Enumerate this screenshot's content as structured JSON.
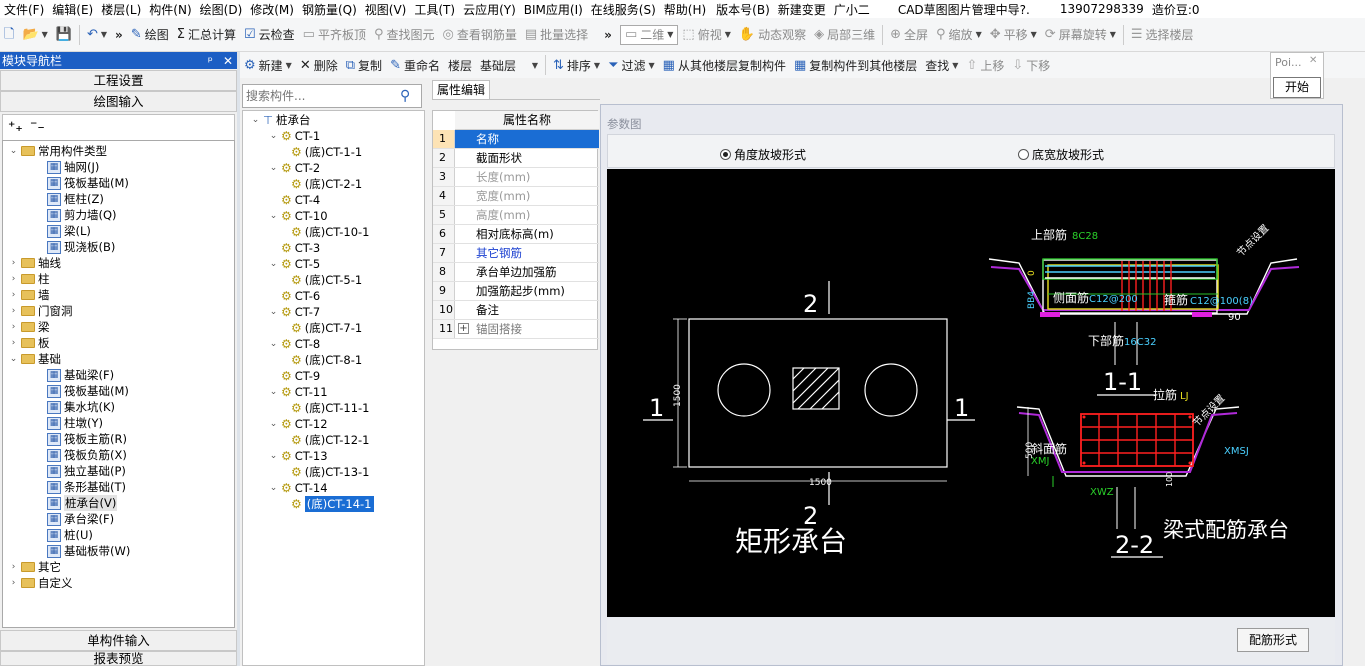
{
  "menu": [
    "文件(F)",
    "编辑(E)",
    "楼层(L)",
    "构件(N)",
    "绘图(D)",
    "修改(M)",
    "钢筋量(Q)",
    "视图(V)",
    "工具(T)",
    "云应用(Y)",
    "BIM应用(I)",
    "在线服务(S)",
    "帮助(H)",
    "版本号(B)",
    "新建变更",
    "广小二",
    "CAD草图图片管理中导?.",
    "13907298339",
    "造价豆:0"
  ],
  "toolbar1": {
    "draw": "绘图",
    "sum": "汇总计算",
    "cloud": "云检查",
    "flat": "平齐板顶",
    "find": "查找图元",
    "view_rebar": "查看钢筋量",
    "batch": "批量选择",
    "mode": "二维",
    "top": "俯视",
    "dynamic": "动态观察",
    "local3d": "局部三维",
    "fullscreen": "全屏",
    "zoom": "缩放",
    "pan": "平移",
    "rotate": "屏幕旋转",
    "select_floor": "选择楼层"
  },
  "nav": {
    "title": "模块导航栏",
    "pin": "ᵖ",
    "project_settings": "工程设置",
    "draw_input": "绘图输入",
    "single_input": "单构件输入",
    "report": "报表预览",
    "tree": [
      {
        "label": "常用构件类型",
        "type": "folder",
        "open": true
      },
      {
        "label": "轴网(J)",
        "type": "item"
      },
      {
        "label": "筏板基础(M)",
        "type": "item"
      },
      {
        "label": "框柱(Z)",
        "type": "item"
      },
      {
        "label": "剪力墙(Q)",
        "type": "item"
      },
      {
        "label": "梁(L)",
        "type": "item"
      },
      {
        "label": "现浇板(B)",
        "type": "item"
      },
      {
        "label": "轴线",
        "type": "folder"
      },
      {
        "label": "柱",
        "type": "folder"
      },
      {
        "label": "墙",
        "type": "folder"
      },
      {
        "label": "门窗洞",
        "type": "folder"
      },
      {
        "label": "梁",
        "type": "folder"
      },
      {
        "label": "板",
        "type": "folder"
      },
      {
        "label": "基础",
        "type": "folder",
        "open": true
      },
      {
        "label": "基础梁(F)",
        "type": "item"
      },
      {
        "label": "筏板基础(M)",
        "type": "item"
      },
      {
        "label": "集水坑(K)",
        "type": "item"
      },
      {
        "label": "柱墩(Y)",
        "type": "item"
      },
      {
        "label": "筏板主筋(R)",
        "type": "item"
      },
      {
        "label": "筏板负筋(X)",
        "type": "item"
      },
      {
        "label": "独立基础(P)",
        "type": "item"
      },
      {
        "label": "条形基础(T)",
        "type": "item"
      },
      {
        "label": "桩承台(V)",
        "type": "item",
        "selected": true
      },
      {
        "label": "承台梁(F)",
        "type": "item"
      },
      {
        "label": "桩(U)",
        "type": "item"
      },
      {
        "label": "基础板带(W)",
        "type": "item"
      },
      {
        "label": "其它",
        "type": "folder"
      },
      {
        "label": "自定义",
        "type": "folder"
      }
    ]
  },
  "toolbar2": {
    "new": "新建",
    "delete": "删除",
    "copy": "复制",
    "rename": "重命名",
    "floor_label": "楼层",
    "floor_value": "基础层",
    "sort": "排序",
    "filter": "过滤",
    "copy_from": "从其他楼层复制构件",
    "copy_to": "复制构件到其他楼层",
    "find": "查找",
    "up": "上移",
    "down": "下移"
  },
  "search": {
    "placeholder": "搜索构件..."
  },
  "components": {
    "root": "桩承台",
    "items": [
      {
        "name": "CT-1",
        "child": "(底)CT-1-1"
      },
      {
        "name": "CT-2",
        "child": "(底)CT-2-1"
      },
      {
        "name": "CT-4",
        "child": null
      },
      {
        "name": "CT-10",
        "child": "(底)CT-10-1"
      },
      {
        "name": "CT-3",
        "child": null
      },
      {
        "name": "CT-5",
        "child": "(底)CT-5-1"
      },
      {
        "name": "CT-6",
        "child": null
      },
      {
        "name": "CT-7",
        "child": "(底)CT-7-1"
      },
      {
        "name": "CT-8",
        "child": "(底)CT-8-1"
      },
      {
        "name": "CT-9",
        "child": null
      },
      {
        "name": "CT-11",
        "child": "(底)CT-11-1"
      },
      {
        "name": "CT-12",
        "child": "(底)CT-12-1"
      },
      {
        "name": "CT-13",
        "child": "(底)CT-13-1"
      },
      {
        "name": "CT-14",
        "child": "(底)CT-14-1"
      }
    ]
  },
  "props": {
    "tab": "属性编辑",
    "header": "属性名称",
    "rows": [
      {
        "no": "1",
        "name": "名称",
        "color": "#1a3fd0"
      },
      {
        "no": "2",
        "name": "截面形状",
        "color": "#000"
      },
      {
        "no": "3",
        "name": "长度(mm)",
        "color": "#999"
      },
      {
        "no": "4",
        "name": "宽度(mm)",
        "color": "#999"
      },
      {
        "no": "5",
        "name": "高度(mm)",
        "color": "#999"
      },
      {
        "no": "6",
        "name": "相对底标高(m)",
        "color": "#000"
      },
      {
        "no": "7",
        "name": "其它钢筋",
        "color": "#1a3fd0"
      },
      {
        "no": "8",
        "name": "承台单边加强筋",
        "color": "#000"
      },
      {
        "no": "9",
        "name": "加强筋起步(mm)",
        "color": "#000"
      },
      {
        "no": "10",
        "name": "备注",
        "color": "#000"
      },
      {
        "no": "11",
        "name": "锚固搭接",
        "color": "#777"
      }
    ]
  },
  "param": {
    "label": "参数图",
    "radio_angle": "角度放坡形式",
    "radio_bottom": "底宽放坡形式",
    "button": "配筋形式"
  },
  "drawing": {
    "sec2_top": "2",
    "sec2_bot": "2",
    "sec1_left": "1",
    "sec1_right": "1",
    "dim_h": "1500",
    "dim_w": "1500",
    "title_left": "矩形承台",
    "title_right": "梁式配筋承台",
    "label_11": "1-1",
    "label_22": "2-2",
    "top_bar": "上部筋",
    "top_bar_val": "8C28",
    "side_bar": "侧面筋",
    "side_bar_val": "C12@200",
    "stir": "箍筋",
    "stir_val": "C12@100(8)",
    "bottom_bar": "下部筋",
    "bottom_bar_val": "16C32",
    "tie": "拉筋",
    "tie_val": "LJ",
    "slope_bar": "斜面筋",
    "slope_val": "XMJ",
    "xwz": "XWZ",
    "xmsj": "XMSJ",
    "angle": "90",
    "zero": "0",
    "node1": "节点设置",
    "node2": "节点设置",
    "bbd": "BB4",
    "d500": "500",
    "d100": "100"
  },
  "popup": {
    "title": "Poi...",
    "btn": "开始"
  }
}
